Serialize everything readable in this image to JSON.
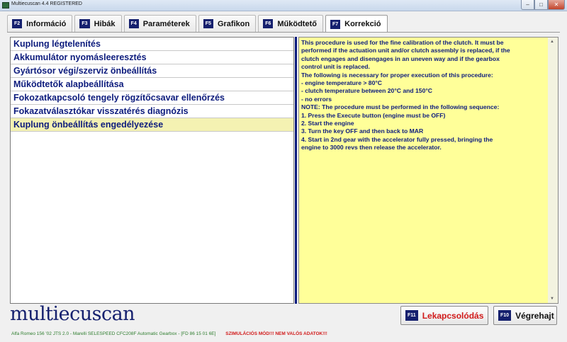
{
  "window": {
    "title": "Multiecuscan 4.4 REGISTERED",
    "controls": {
      "minimize": "–",
      "maximize": "□",
      "close": "✕"
    }
  },
  "tabs": [
    {
      "key": "F2",
      "label": "Információ"
    },
    {
      "key": "F3",
      "label": "Hibák"
    },
    {
      "key": "F4",
      "label": "Paraméterek"
    },
    {
      "key": "F5",
      "label": "Grafikon"
    },
    {
      "key": "F6",
      "label": "Működtető"
    },
    {
      "key": "F7",
      "label": "Korrekció"
    }
  ],
  "procedures": [
    "Kuplung légtelenítés",
    "Akkumulátor nyomásleeresztés",
    "Gyártósor végi/szerviz önbeállítás",
    "Működtetők alapbeállítása",
    "Fokozatkapcsoló tengely rögzítőcsavar ellenőrzés",
    "Fokazatválasztókar visszatérés diagnózis",
    "Kuplung önbeállítás engedélyezése"
  ],
  "selected_procedure_index": 6,
  "description_lines": [
    "This procedure is used for the fine calibration of the clutch. It must be",
    "performed if the actuation unit and/or clutch assembly is replaced, if the",
    "clutch engages and disengages in an uneven way and if the gearbox",
    "control unit is replaced.",
    "The following is necessary for proper execution of this procedure:",
    "- engine temperature > 80°C",
    "- clutch temperature between 20°C and 150°C",
    "- no errors",
    "NOTE: The procedure must be performed in the following sequence:",
    "1. Press the Execute button (engine must be OFF)",
    "2. Start the engine",
    "3. Turn the key OFF and then back to MAR",
    "4. Start in 2nd gear with the accelerator fully pressed, bringing the",
    "engine to 3000 revs then release the accelerator."
  ],
  "footer": {
    "logo": "multiecuscan",
    "disconnect": {
      "key": "F11",
      "label": "Lekapcsolódás"
    },
    "execute": {
      "key": "F10",
      "label": "Végrehajt"
    }
  },
  "status": {
    "vehicle": "Alfa Romeo 156 '02 JTS 2.0 - Marelli SELESPEED CFC208F Automatic Gearbox - [FD 86 15 01 6E]",
    "simulation": "SZIMULÁCIÓS MÓD!!! NEM VALÓS ADATOK!!!"
  },
  "colors": {
    "accent": "#15206e",
    "list_text": "#0d1c7d",
    "selected": "#f4f2b2",
    "description_bg": "#ffff99",
    "warning": "#d11a1a"
  }
}
